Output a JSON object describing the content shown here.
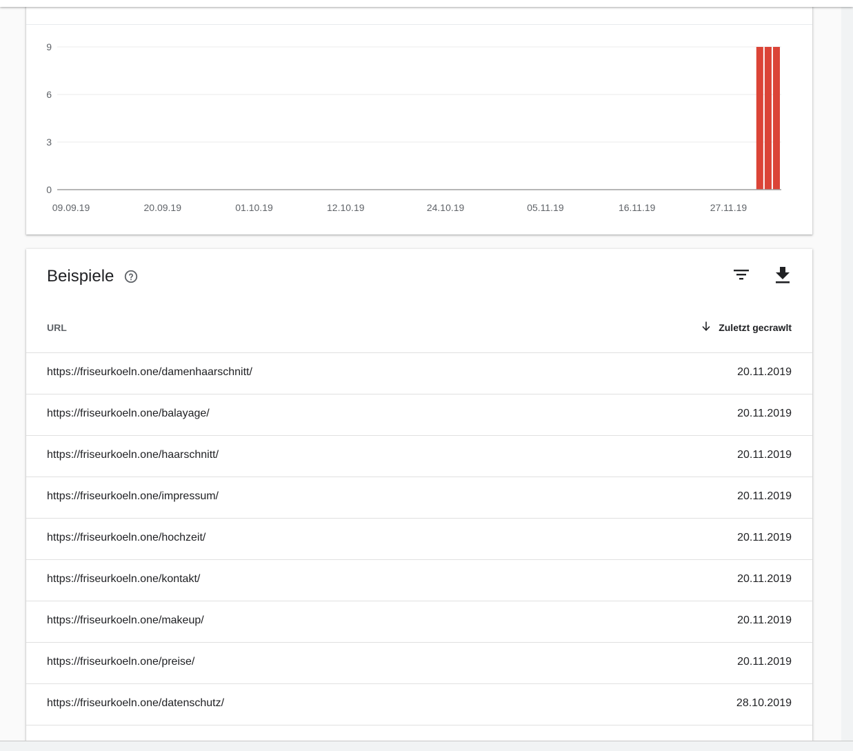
{
  "chart_data": {
    "type": "bar",
    "title": "",
    "xlabel": "",
    "ylabel": "",
    "ylim": [
      0,
      9
    ],
    "y_ticks": [
      0,
      3,
      6,
      9
    ],
    "x_ticks": [
      "09.09.19",
      "20.09.19",
      "01.10.19",
      "12.10.19",
      "24.10.19",
      "05.11.19",
      "16.11.19",
      "27.11.19"
    ],
    "x_tick_dates": [
      "2019-09-09",
      "2019-09-20",
      "2019-10-01",
      "2019-10-12",
      "2019-10-24",
      "2019-11-05",
      "2019-11-16",
      "2019-11-27"
    ],
    "x_range": [
      "2019-09-09",
      "2019-12-05"
    ],
    "grid": true,
    "color": "#db4437",
    "points": [
      {
        "date": "2019-12-02",
        "value": 9
      },
      {
        "date": "2019-12-03",
        "value": 9
      },
      {
        "date": "2019-12-04",
        "value": 9
      }
    ]
  },
  "examples": {
    "title": "Beispiele",
    "help_icon": "help-circle-icon",
    "filter_icon": "filter-icon",
    "download_icon": "download-icon",
    "columns": {
      "url": "URL",
      "last_crawled": "Zuletzt gecrawlt",
      "sort_icon": "arrow-down-icon"
    },
    "rows": [
      {
        "url": "https://friseurkoeln.one/damenhaarschnitt/",
        "date": "20.11.2019"
      },
      {
        "url": "https://friseurkoeln.one/balayage/",
        "date": "20.11.2019"
      },
      {
        "url": "https://friseurkoeln.one/haarschnitt/",
        "date": "20.11.2019"
      },
      {
        "url": "https://friseurkoeln.one/impressum/",
        "date": "20.11.2019"
      },
      {
        "url": "https://friseurkoeln.one/hochzeit/",
        "date": "20.11.2019"
      },
      {
        "url": "https://friseurkoeln.one/kontakt/",
        "date": "20.11.2019"
      },
      {
        "url": "https://friseurkoeln.one/makeup/",
        "date": "20.11.2019"
      },
      {
        "url": "https://friseurkoeln.one/preise/",
        "date": "20.11.2019"
      },
      {
        "url": "https://friseurkoeln.one/datenschutz/",
        "date": "28.10.2019"
      }
    ]
  }
}
